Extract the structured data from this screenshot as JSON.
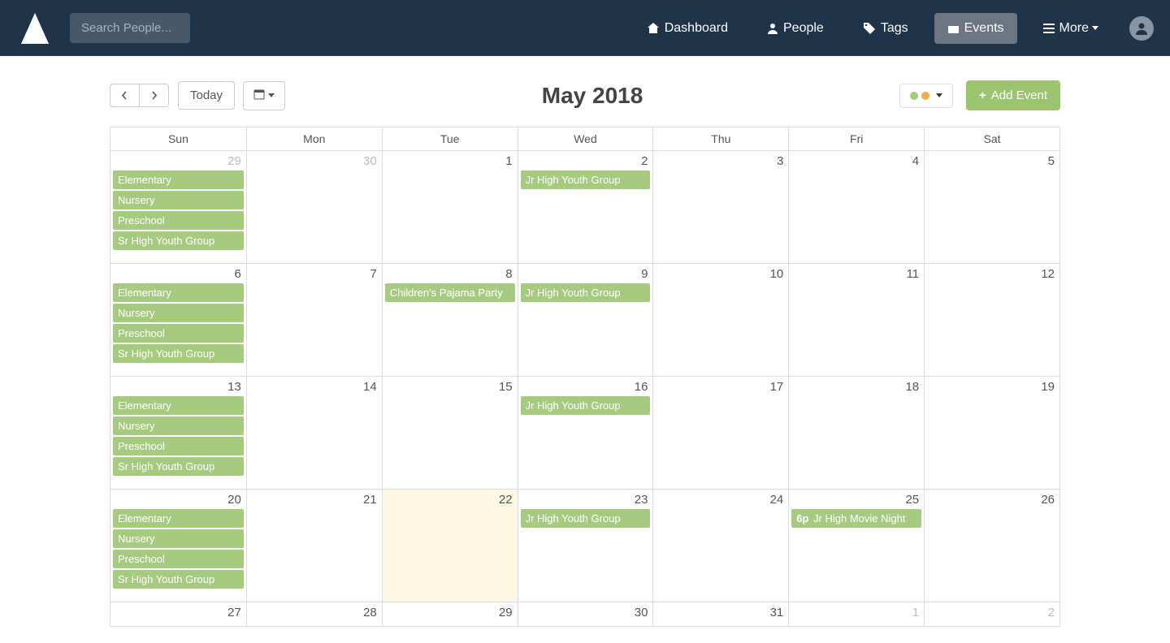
{
  "header": {
    "search_placeholder": "Search People...",
    "nav": {
      "dashboard": "Dashboard",
      "people": "People",
      "tags": "Tags",
      "events": "Events",
      "more": "More"
    }
  },
  "toolbar": {
    "today_label": "Today",
    "title": "May 2018",
    "add_event_label": "Add Event",
    "filter_colors": [
      "#a7ca81",
      "#f0ad4e"
    ]
  },
  "calendar": {
    "day_headers": [
      "Sun",
      "Mon",
      "Tue",
      "Wed",
      "Thu",
      "Fri",
      "Sat"
    ],
    "weeks": [
      {
        "days": [
          {
            "num": "29",
            "other_month": true,
            "events": [
              {
                "label": "Elementary"
              },
              {
                "label": "Nursery"
              },
              {
                "label": "Preschool"
              },
              {
                "label": "Sr High Youth Group"
              }
            ]
          },
          {
            "num": "30",
            "other_month": true,
            "events": []
          },
          {
            "num": "1",
            "events": []
          },
          {
            "num": "2",
            "events": [
              {
                "label": "Jr High Youth Group"
              }
            ]
          },
          {
            "num": "3",
            "events": []
          },
          {
            "num": "4",
            "events": []
          },
          {
            "num": "5",
            "events": []
          }
        ]
      },
      {
        "days": [
          {
            "num": "6",
            "events": [
              {
                "label": "Elementary"
              },
              {
                "label": "Nursery"
              },
              {
                "label": "Preschool"
              },
              {
                "label": "Sr High Youth Group"
              }
            ]
          },
          {
            "num": "7",
            "events": []
          },
          {
            "num": "8",
            "events": [
              {
                "label": "Children's Pajama Party"
              }
            ]
          },
          {
            "num": "9",
            "events": [
              {
                "label": "Jr High Youth Group"
              }
            ]
          },
          {
            "num": "10",
            "events": []
          },
          {
            "num": "11",
            "events": []
          },
          {
            "num": "12",
            "events": []
          }
        ]
      },
      {
        "days": [
          {
            "num": "13",
            "events": [
              {
                "label": "Elementary"
              },
              {
                "label": "Nursery"
              },
              {
                "label": "Preschool"
              },
              {
                "label": "Sr High Youth Group"
              }
            ]
          },
          {
            "num": "14",
            "events": []
          },
          {
            "num": "15",
            "events": []
          },
          {
            "num": "16",
            "events": [
              {
                "label": "Jr High Youth Group"
              }
            ]
          },
          {
            "num": "17",
            "events": []
          },
          {
            "num": "18",
            "events": []
          },
          {
            "num": "19",
            "events": []
          }
        ]
      },
      {
        "days": [
          {
            "num": "20",
            "events": [
              {
                "label": "Elementary"
              },
              {
                "label": "Nursery"
              },
              {
                "label": "Preschool"
              },
              {
                "label": "Sr High Youth Group"
              }
            ]
          },
          {
            "num": "21",
            "events": []
          },
          {
            "num": "22",
            "today": true,
            "events": []
          },
          {
            "num": "23",
            "events": [
              {
                "label": "Jr High Youth Group"
              }
            ]
          },
          {
            "num": "24",
            "events": []
          },
          {
            "num": "25",
            "events": [
              {
                "time": "6p",
                "label": "Jr High Movie Night"
              }
            ]
          },
          {
            "num": "26",
            "events": []
          }
        ]
      },
      {
        "last": true,
        "days": [
          {
            "num": "27",
            "events": []
          },
          {
            "num": "28",
            "events": []
          },
          {
            "num": "29",
            "events": []
          },
          {
            "num": "30",
            "events": []
          },
          {
            "num": "31",
            "events": []
          },
          {
            "num": "1",
            "other_month": true,
            "events": []
          },
          {
            "num": "2",
            "other_month": true,
            "events": []
          }
        ]
      }
    ]
  }
}
